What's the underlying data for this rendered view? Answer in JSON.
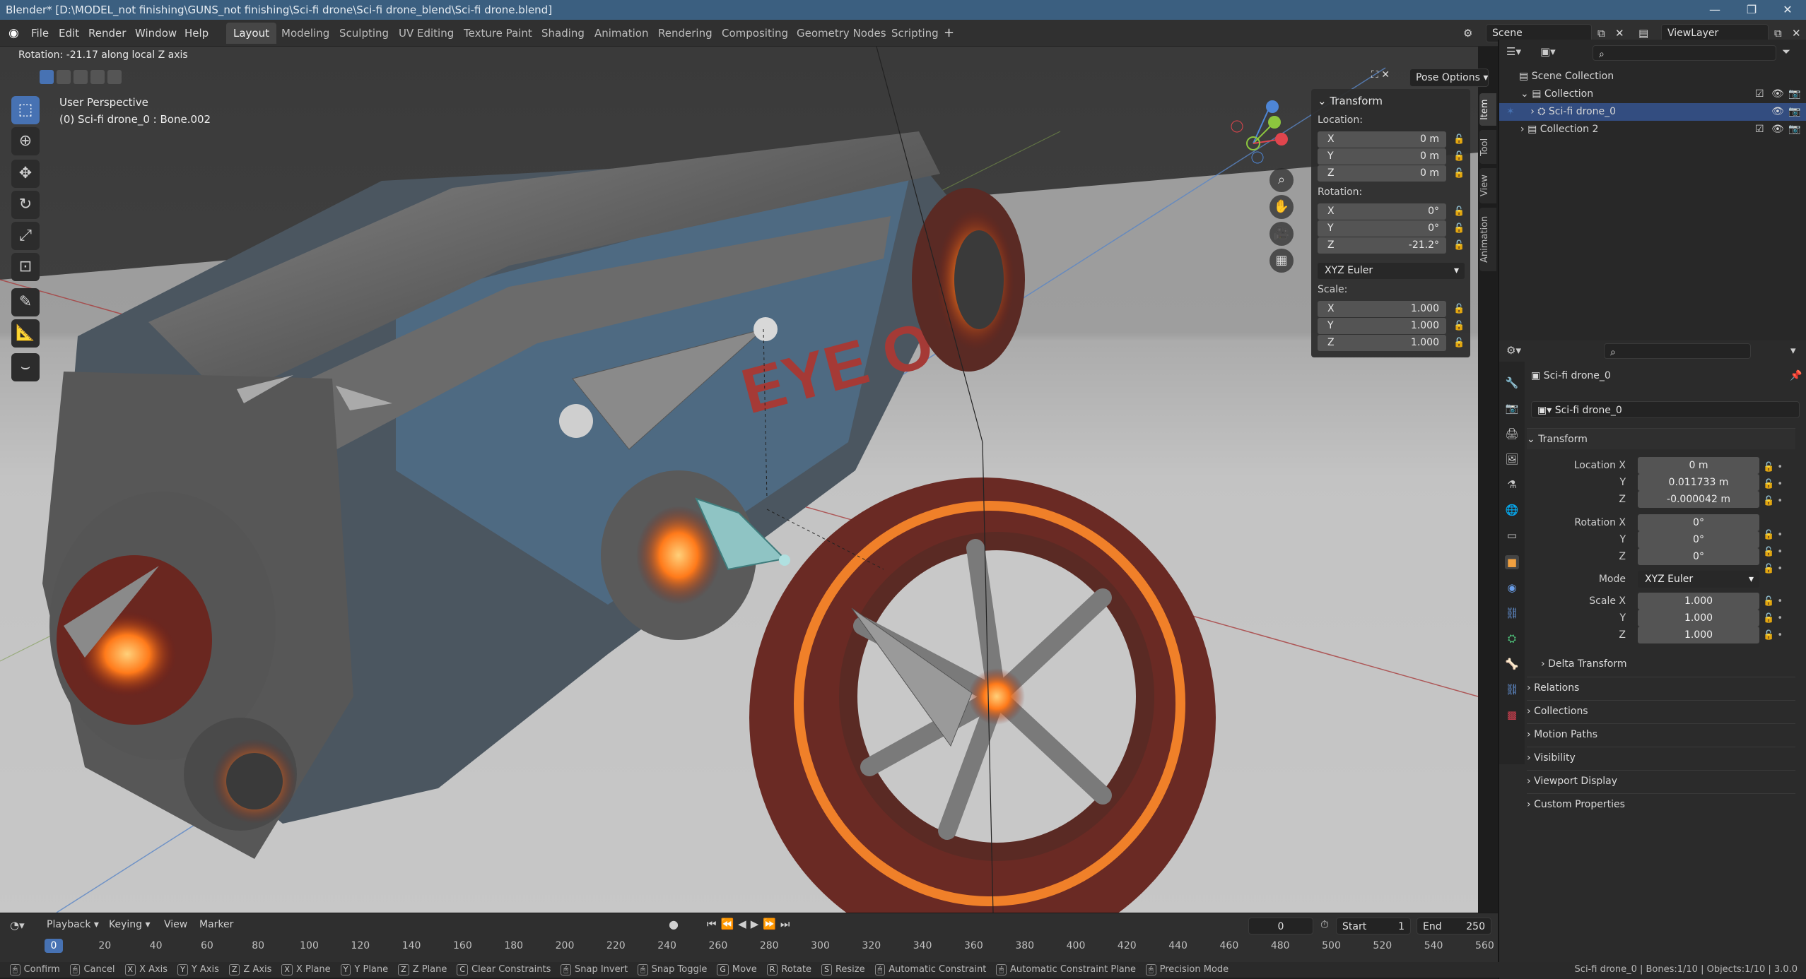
{
  "window": {
    "title": "Blender* [D:\\MODEL_not finishing\\GUNS_not finishing\\Sci-fi drone\\Sci-fi drone_blend\\Sci-fi drone.blend]"
  },
  "menu": [
    "File",
    "Edit",
    "Render",
    "Window",
    "Help"
  ],
  "workspaces": [
    "Layout",
    "Modeling",
    "Sculpting",
    "UV Editing",
    "Texture Paint",
    "Shading",
    "Animation",
    "Rendering",
    "Compositing",
    "Geometry Nodes",
    "Scripting"
  ],
  "active_workspace": "Layout",
  "scene": {
    "name": "Scene",
    "view_layer": "ViewLayer"
  },
  "viewport": {
    "header_status": "Rotation: -21.17 along local Z axis",
    "perspective": "User Perspective",
    "object_info": "(0) Sci-fi drone_0 : Bone.002",
    "pose_options": "Pose Options",
    "text_on_model": "EYE O"
  },
  "npanel": {
    "title": "Transform",
    "location_label": "Location:",
    "location": [
      {
        "axis": "X",
        "value": "0 m"
      },
      {
        "axis": "Y",
        "value": "0 m"
      },
      {
        "axis": "Z",
        "value": "0 m"
      }
    ],
    "rotation_label": "Rotation:",
    "rotation": [
      {
        "axis": "X",
        "value": "0°"
      },
      {
        "axis": "Y",
        "value": "0°"
      },
      {
        "axis": "Z",
        "value": "-21.2°"
      }
    ],
    "rotation_mode": "XYZ Euler",
    "scale_label": "Scale:",
    "scale": [
      {
        "axis": "X",
        "value": "1.000"
      },
      {
        "axis": "Y",
        "value": "1.000"
      },
      {
        "axis": "Z",
        "value": "1.000"
      }
    ]
  },
  "side_tabs": [
    "Item",
    "Tool",
    "View",
    "Animation"
  ],
  "outliner": {
    "rows": [
      {
        "label": "Scene Collection"
      },
      {
        "label": "Collection"
      },
      {
        "label": "Sci-fi drone_0"
      },
      {
        "label": "Collection 2"
      }
    ]
  },
  "properties": {
    "object_name": "Sci-fi drone_0",
    "data_name": "Sci-fi drone_0",
    "transform_title": "Transform",
    "location": {
      "label_x": "Location X",
      "x": "0 m",
      "y": "0.011733 m",
      "z": "-0.000042 m"
    },
    "rotation": {
      "label_x": "Rotation X",
      "x": "0°",
      "y": "0°",
      "z": "0°"
    },
    "mode_label": "Mode",
    "mode": "XYZ Euler",
    "scale": {
      "label_x": "Scale X",
      "x": "1.000",
      "y": "1.000",
      "z": "1.000"
    },
    "axis_y": "Y",
    "axis_z": "Z",
    "delta": "Delta Transform",
    "sections": [
      "Relations",
      "Collections",
      "Motion Paths",
      "Visibility",
      "Viewport Display",
      "Custom Properties"
    ]
  },
  "timeline": {
    "menus": [
      "Playback",
      "Keying",
      "View",
      "Marker"
    ],
    "current_frame": "0",
    "start_label": "Start",
    "start": "1",
    "end_label": "End",
    "end": "250",
    "ticks": [
      "0",
      "20",
      "40",
      "60",
      "80",
      "100",
      "120",
      "140",
      "160",
      "180",
      "200",
      "220",
      "240",
      "260",
      "280",
      "300",
      "320",
      "340",
      "360",
      "380",
      "400",
      "420",
      "440",
      "460",
      "480",
      "500",
      "520",
      "540",
      "560"
    ]
  },
  "statusbar": {
    "items": [
      "Confirm",
      "Cancel",
      "X Axis",
      "Y Axis",
      "Z Axis",
      "X Plane",
      "Y Plane",
      "Z Plane",
      "Clear Constraints",
      "Snap Invert",
      "Snap Toggle",
      "Move",
      "Rotate",
      "Resize",
      "Automatic Constraint",
      "Automatic Constraint Plane",
      "Precision Mode"
    ],
    "keys": [
      "",
      "",
      "X",
      "Y",
      "Z",
      "X",
      "Y",
      "Z",
      "C",
      "",
      "",
      "G",
      "R",
      "S",
      "",
      "",
      ""
    ],
    "right": "Sci-fi drone_0 | Bones:1/10 | Objects:1/10 | 3.0.0"
  },
  "colors": {
    "accent": "#4772b3",
    "selected_row": "#334d80",
    "title_bar": "#3b5f80",
    "glow": "#ff7a1a"
  }
}
